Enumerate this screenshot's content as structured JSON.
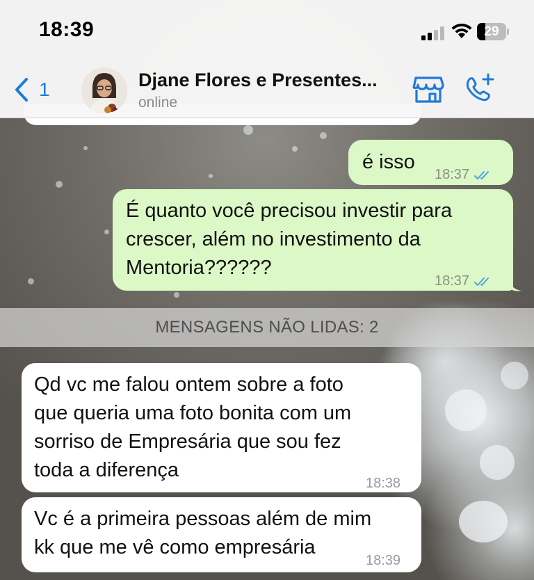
{
  "status_bar": {
    "time": "18:39",
    "battery_level": "29",
    "battery_fraction": 0.29
  },
  "header": {
    "back_count": "1",
    "contact_name": "Djane Flores e Presentes...",
    "contact_status": "online",
    "icons": {
      "back": "chevron-left-icon",
      "shop": "storefront-icon",
      "call": "add-call-icon"
    },
    "accent_color": "#1f7ad9"
  },
  "messages": [
    {
      "direction": "outgoing",
      "text": "é isso",
      "time": "18:37",
      "status": "read"
    },
    {
      "direction": "outgoing",
      "lines": [
        "É quanto você precisou investir para",
        "crescer, além no investimento da",
        "Mentoria??????"
      ],
      "time": "18:37",
      "status": "read"
    },
    {
      "direction": "incoming",
      "lines": [
        "Qd vc me falou ontem sobre a foto",
        "que queria uma foto bonita com um",
        "sorriso de Empresária que sou fez",
        "toda a diferença"
      ],
      "time": "18:38"
    },
    {
      "direction": "incoming",
      "lines": [
        "Vc é a primeira pessoas além de mim",
        "kk que me vê como empresária"
      ],
      "time": "18:39"
    }
  ],
  "unread_divider": "MENSAGENS NÃO LIDAS: 2",
  "colors": {
    "outgoing_bubble": "#dbf8c6",
    "incoming_bubble": "#ffffff",
    "read_ticks": "#4fa3e8"
  }
}
